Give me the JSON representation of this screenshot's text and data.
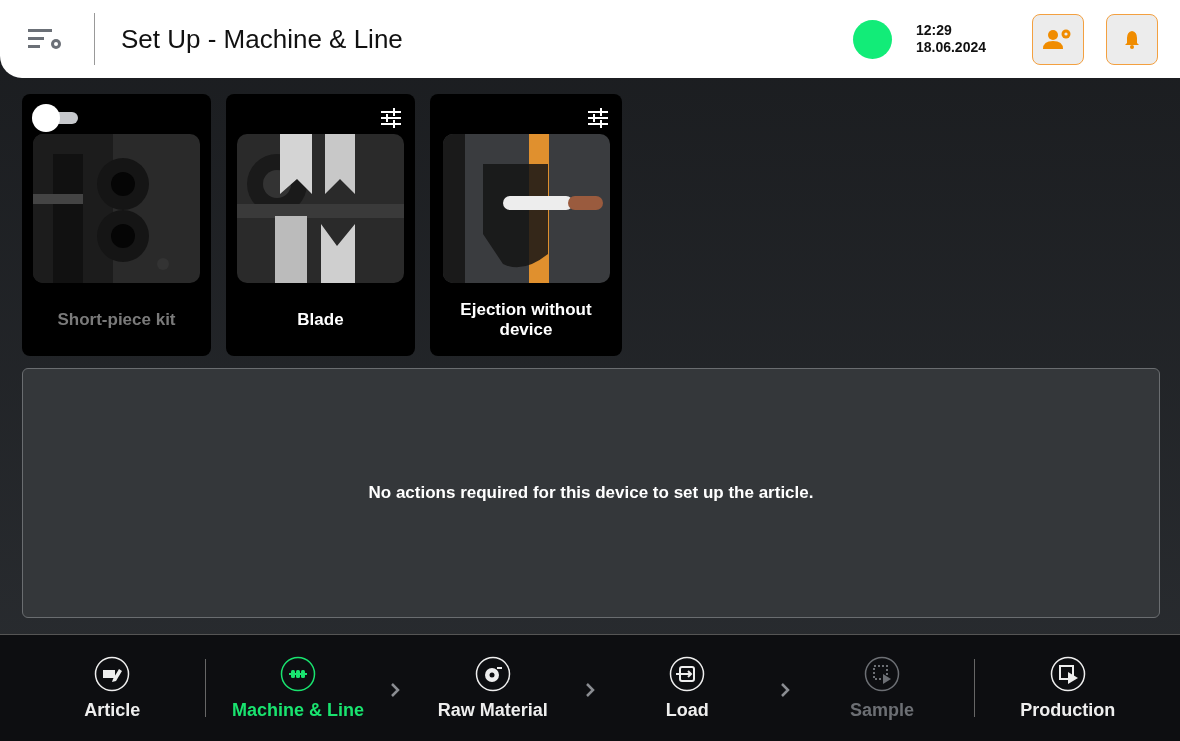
{
  "header": {
    "title": "Set Up - Machine & Line",
    "status": {
      "color": "#12ec78"
    },
    "time": "12:29",
    "date": "18.06.2024"
  },
  "devices": [
    {
      "kind": "toggle",
      "on": false,
      "title": "Short-piece kit",
      "disabled": true
    },
    {
      "kind": "settings",
      "title": "Blade",
      "disabled": false
    },
    {
      "kind": "settings",
      "title": "Ejection without device",
      "disabled": false
    }
  ],
  "message": "No actions required for this device to set up the article.",
  "steps": [
    {
      "label": "Article",
      "selected": false,
      "disabled": false
    },
    {
      "label": "Machine & Line",
      "selected": true,
      "disabled": false
    },
    {
      "label": "Raw Material",
      "selected": false,
      "disabled": false
    },
    {
      "label": "Load",
      "selected": false,
      "disabled": false
    },
    {
      "label": "Sample",
      "selected": false,
      "disabled": true
    },
    {
      "label": "Production",
      "selected": false,
      "disabled": false
    }
  ]
}
